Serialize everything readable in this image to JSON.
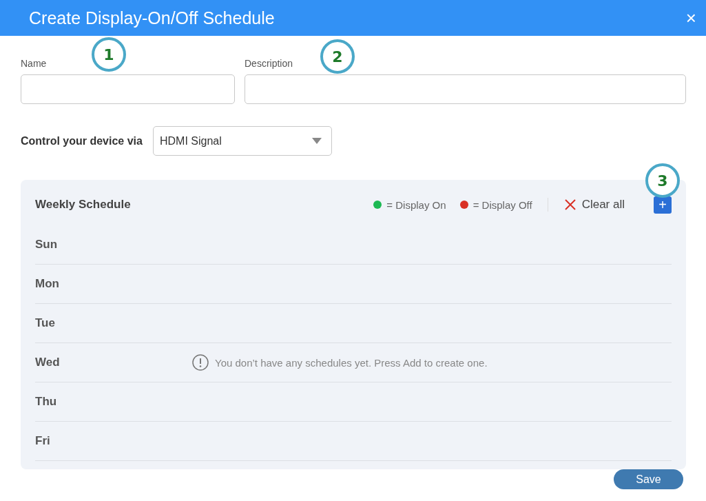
{
  "dialog": {
    "title": "Create Display-On/Off Schedule",
    "close": "×"
  },
  "fields": [
    {
      "label": "Name"
    },
    {
      "label": "Description"
    }
  ],
  "control": {
    "label": "Control your device via",
    "value": "HDMI Signal"
  },
  "schedule": {
    "title": "Weekly Schedule",
    "legend": [
      {
        "label": "= Display On",
        "color": "#1db954"
      },
      {
        "label": "= Display Off",
        "color": "#d93025"
      }
    ],
    "clear_all": "Clear all",
    "add": "+",
    "days": [
      {
        "label": "Sun"
      },
      {
        "label": "Mon"
      },
      {
        "label": "Tue"
      },
      {
        "label": "Wed",
        "message": "You don’t have any schedules yet. Press Add to create one."
      },
      {
        "label": "Thu"
      },
      {
        "label": "Fri"
      }
    ]
  },
  "save": "Save",
  "callouts": [
    "1",
    "2",
    "3"
  ]
}
